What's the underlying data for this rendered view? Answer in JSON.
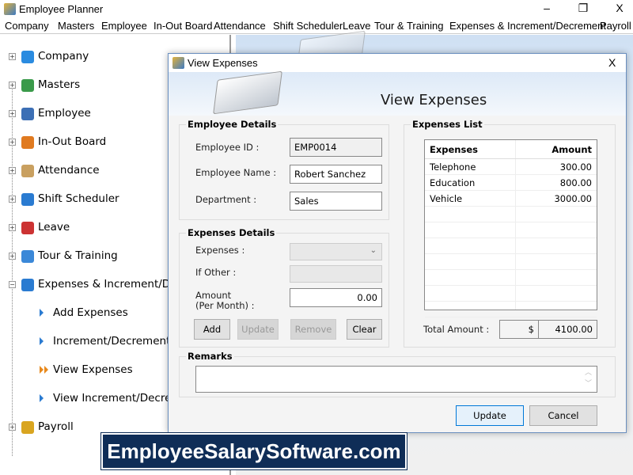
{
  "window": {
    "title": "Employee Planner",
    "minimize": "–",
    "restore": "❐",
    "close": "X"
  },
  "menu": [
    "Company",
    "Masters",
    "Employee",
    "In-Out Board",
    "Attendance",
    "Shift Scheduler",
    "Leave",
    "Tour & Training",
    "Expenses & Increment/Decrement",
    "Payroll"
  ],
  "tree": {
    "items": [
      {
        "label": "Company",
        "icon": "building-icon",
        "color": "#2a8be0"
      },
      {
        "label": "Masters",
        "icon": "layers-icon",
        "color": "#3a9a4a"
      },
      {
        "label": "Employee",
        "icon": "people-icon",
        "color": "#3c6fb5"
      },
      {
        "label": "In-Out Board",
        "icon": "arrows-icon",
        "color": "#e07a20"
      },
      {
        "label": "Attendance",
        "icon": "clipboard-icon",
        "color": "#c9a060"
      },
      {
        "label": "Shift Scheduler",
        "icon": "clock-icon",
        "color": "#2a7bd1"
      },
      {
        "label": "Leave",
        "icon": "calendar-icon",
        "color": "#c33"
      },
      {
        "label": "Tour & Training",
        "icon": "plane-icon",
        "color": "#3b88d8"
      },
      {
        "label": "Expenses & Increment/Decrement",
        "icon": "wallet-icon",
        "color": "#2a7bd1"
      },
      {
        "label": "Payroll",
        "icon": "coin-icon",
        "color": "#d9a520"
      }
    ],
    "children": [
      {
        "label": "Add Expenses",
        "selected": false
      },
      {
        "label": "Increment/Decrement",
        "selected": false
      },
      {
        "label": "View Expenses",
        "selected": true
      },
      {
        "label": "View Increment/Decrement",
        "selected": false
      }
    ]
  },
  "dialog": {
    "title": "View Expenses",
    "header": "View Expenses",
    "employee": {
      "group": "Employee Details",
      "id_label": "Employee ID :",
      "id": "EMP0014",
      "name_label": "Employee Name :",
      "name": "Robert Sanchez",
      "dept_label": "Department :",
      "dept": "Sales"
    },
    "details": {
      "group": "Expenses Details",
      "expenses_label": "Expenses :",
      "expenses_value": "",
      "other_label": "If Other :",
      "other_value": "",
      "amount_label": "Amount",
      "amount_label2": "(Per Month) :",
      "amount": "0.00",
      "add": "Add",
      "update": "Update",
      "remove": "Remove",
      "clear": "Clear"
    },
    "list": {
      "group": "Expenses List",
      "headers": [
        "Expenses",
        "Amount"
      ],
      "rows": [
        [
          "Telephone",
          "300.00"
        ],
        [
          "Education",
          "800.00"
        ],
        [
          "Vehicle",
          "3000.00"
        ]
      ],
      "total_label": "Total Amount :",
      "currency": "$",
      "total": "4100.00"
    },
    "remarks": {
      "group": "Remarks",
      "value": ""
    },
    "update": "Update",
    "cancel": "Cancel",
    "close": "X"
  },
  "promo": "EmployeeSalarySoftware.com"
}
